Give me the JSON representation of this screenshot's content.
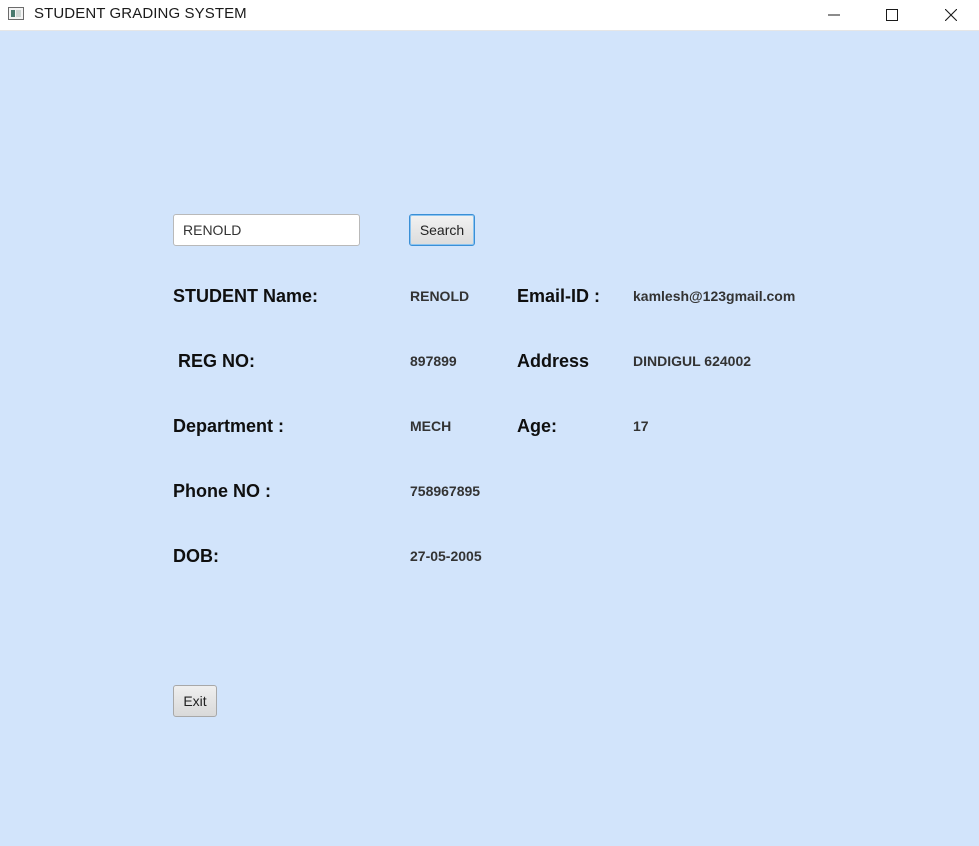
{
  "window": {
    "title": "STUDENT GRADING SYSTEM",
    "icons": [
      "app-window-icon",
      "minimize-icon",
      "maximize-icon",
      "close-icon"
    ]
  },
  "search": {
    "value": "RENOLD",
    "button_label": "Search"
  },
  "fields": {
    "student_name": {
      "label": "STUDENT Name:",
      "value": "RENOLD"
    },
    "reg_no": {
      "label": "REG NO:",
      "value": "897899"
    },
    "department": {
      "label": "Department :",
      "value": "MECH"
    },
    "phone_no": {
      "label": "Phone NO :",
      "value": "758967895"
    },
    "dob": {
      "label": "DOB:",
      "value": "27-05-2005"
    },
    "email": {
      "label": "Email-ID :",
      "value": "kamlesh@123gmail.com"
    },
    "address": {
      "label": "Address",
      "value": "DINDIGUL 624002"
    },
    "age": {
      "label": "Age:",
      "value": "17"
    }
  },
  "actions": {
    "exit_label": "Exit"
  },
  "colors": {
    "background": "#d2e4fb",
    "titlebar": "#ffffff",
    "focus_border": "#3a8fd6"
  }
}
